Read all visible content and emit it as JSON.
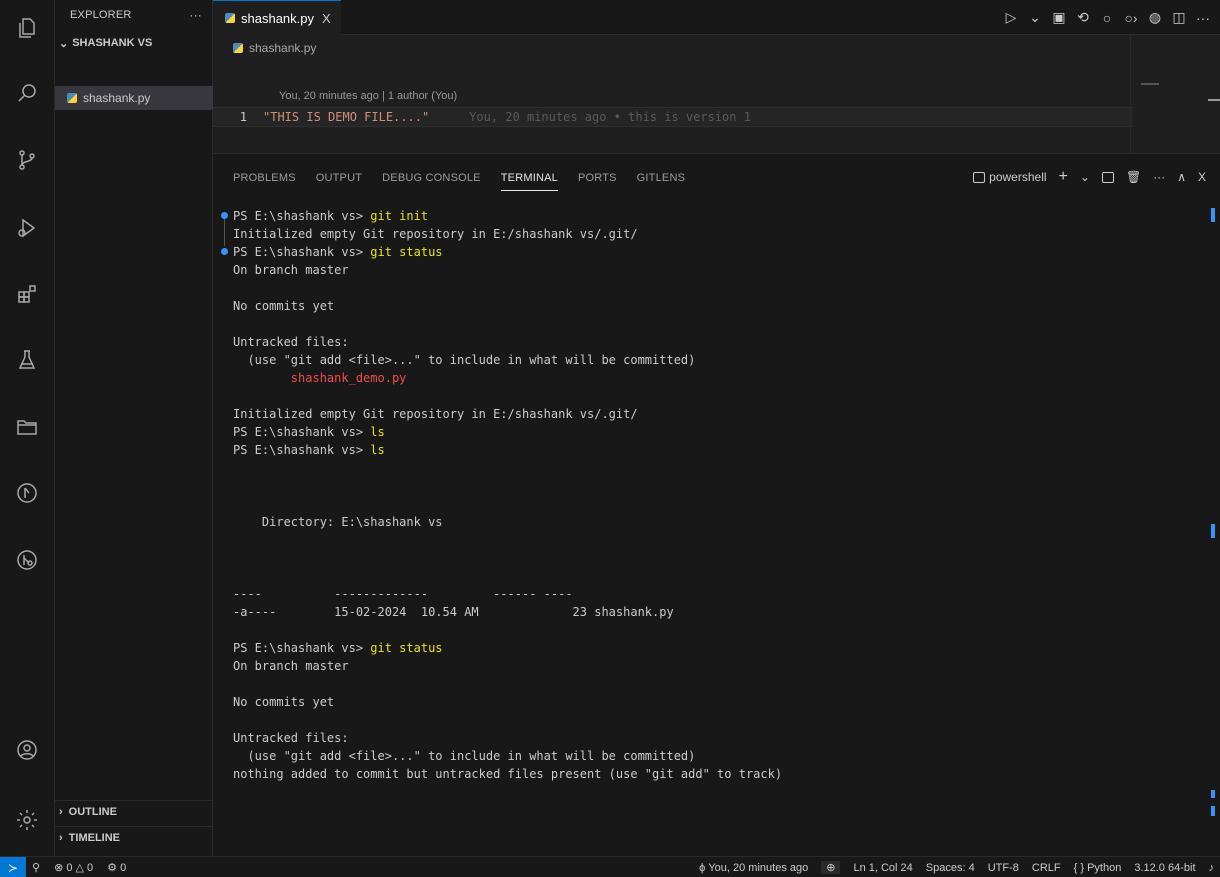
{
  "tab": {
    "label": "shashank.py",
    "close": "X"
  },
  "editor_actions": [
    "▷",
    "⌄",
    "▣",
    "⟲",
    "○",
    "○›",
    "◍",
    "◫",
    "···"
  ],
  "sidebar": {
    "title": "EXPLORER",
    "more": "···",
    "folder": "SHASHANK VS",
    "file": "shashank.py",
    "outline": "OUTLINE",
    "timeline": "TIMELINE"
  },
  "editor": {
    "breadcrumb": "shashank.py",
    "codelens": "You, 20 minutes ago | 1 author (You)",
    "line_number": "1",
    "code": "\"THIS IS DEMO FILE....\"",
    "blame": "You, 20 minutes ago • this is version 1"
  },
  "panel": {
    "tabs": [
      "PROBLEMS",
      "OUTPUT",
      "DEBUG CONSOLE",
      "TERMINAL",
      "PORTS",
      "GITLENS"
    ],
    "active_tab": "TERMINAL",
    "terminal_name": "powershell",
    "actions": [
      "+",
      "⌄",
      "···",
      "∧",
      "X"
    ]
  },
  "terminal": {
    "prompt": "PS E:\\shashank vs> ",
    "cmd1": "git init",
    "init_out": "Initialized empty Git repository in E:/shashank vs/.git/",
    "cmd2": "git status",
    "branch": "On branch master",
    "no_commits": "No commits yet",
    "untracked": "Untracked files:",
    "hint": "  (use \"git add <file>...\" to include in what will be committed)",
    "untracked_file": "        shashank_demo.py",
    "init_out2": "Initialized empty Git repository in E:/shashank vs/.git/",
    "cmd3": "ls",
    "cmd4": "ls",
    "dir_label": "    Directory: E:\\shashank vs",
    "dashes": "----          -------------         ------ ----",
    "file_row": "-a----        15-02-2024  10.54 AM             23 shashank.py",
    "cmd5": "git status",
    "branch2": "On branch master",
    "no_commits2": "No commits yet",
    "untracked2": "Untracked files:",
    "hint2": "  (use \"git add <file>...\" to include in what will be committed)",
    "nothing": "nothing added to commit but untracked files present (use \"git add\" to track)"
  },
  "statusbar": {
    "remote": "≻",
    "branch_icon": "⚲",
    "problems": "⊗ 0 △ 0",
    "ports": "⚙ 0",
    "blame": "You, 20 minutes ago",
    "zoom": "⊕",
    "position": "Ln 1, Col 24",
    "spaces": "Spaces: 4",
    "encoding": "UTF-8",
    "eol": "CRLF",
    "language": "{ } Python",
    "interpreter": "3.12.0 64-bit",
    "bell": "♪"
  }
}
